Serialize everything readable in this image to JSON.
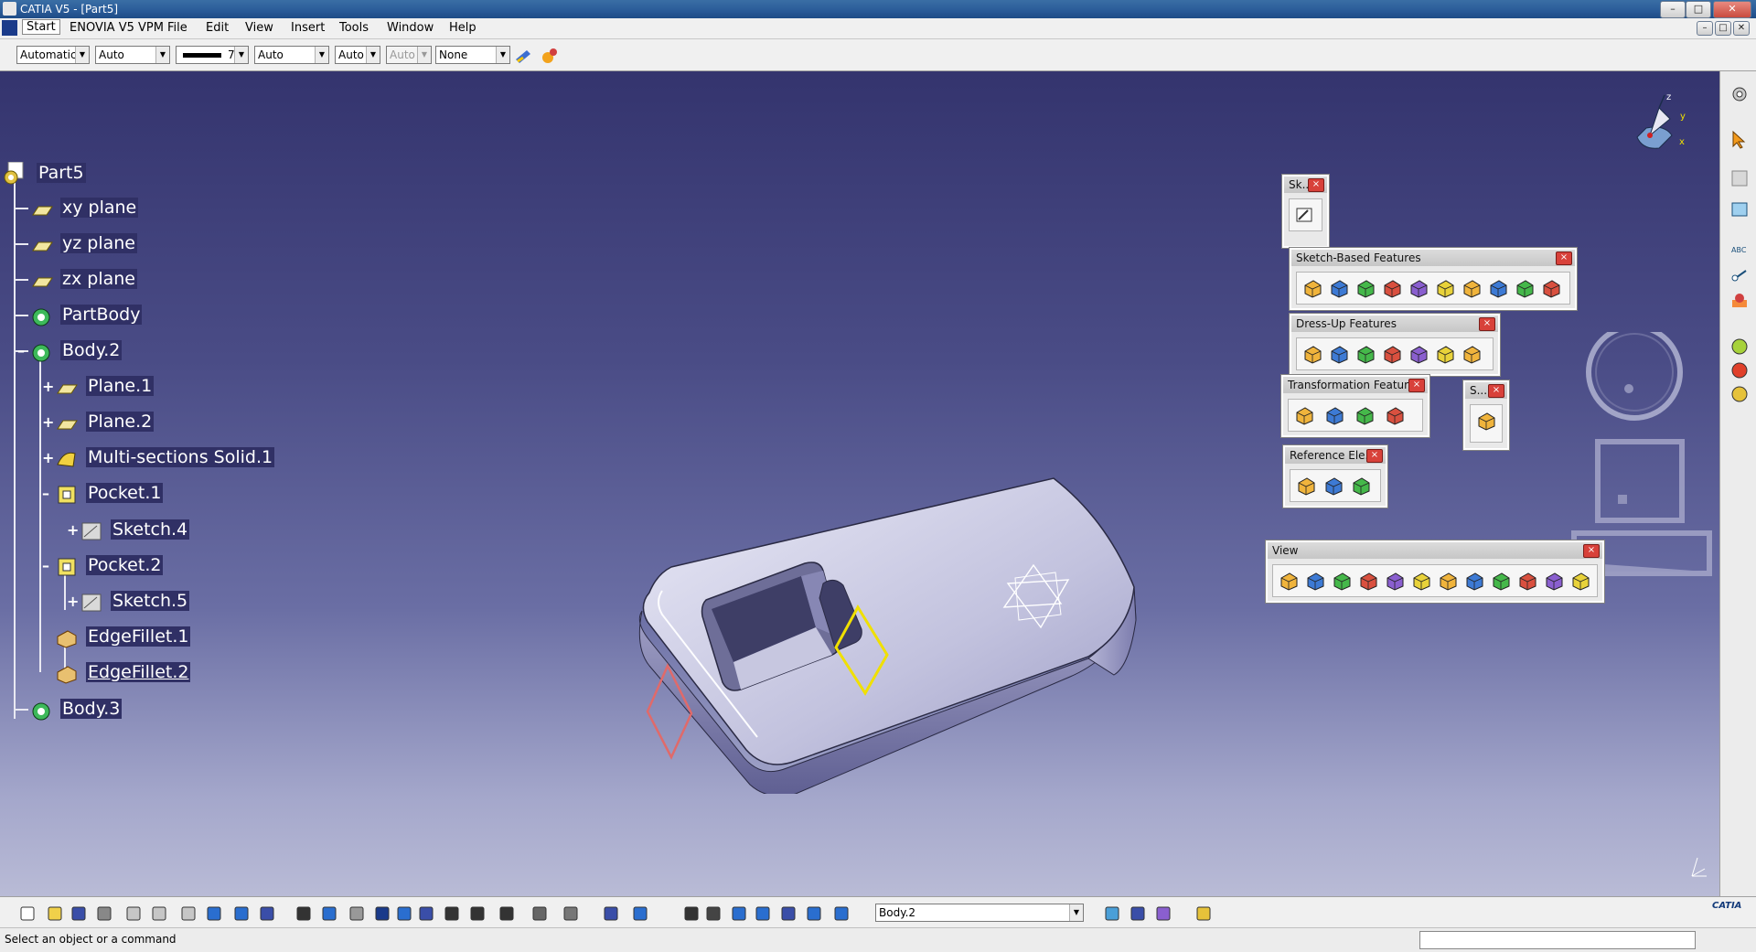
{
  "window": {
    "title": "CATIA V5 - [Part5]",
    "min": "–",
    "max": "□",
    "close": "✕",
    "child_min": "–",
    "child_max": "□",
    "child_close": "✕"
  },
  "menu": {
    "items": [
      "Start",
      "ENOVIA V5 VPM",
      "File",
      "Edit",
      "View",
      "Insert",
      "Tools",
      "Window",
      "Help"
    ]
  },
  "props": {
    "color": "Automatic",
    "transparency": "Auto",
    "line_weight": "7",
    "line_type": "Auto",
    "point_symbol": "Auto",
    "render_style": "Auto",
    "layer": "None"
  },
  "tree": {
    "root": "Part5",
    "items": [
      {
        "label": "xy plane",
        "icon": "plane-icon"
      },
      {
        "label": "yz plane",
        "icon": "plane-icon"
      },
      {
        "label": "zx plane",
        "icon": "plane-icon"
      },
      {
        "label": "PartBody",
        "icon": "body-icon"
      },
      {
        "label": "Body.2",
        "icon": "body-icon"
      },
      {
        "label": "Plane.1",
        "icon": "plane-icon"
      },
      {
        "label": "Plane.2",
        "icon": "plane-icon"
      },
      {
        "label": "Multi-sections Solid.1",
        "icon": "multisection-icon"
      },
      {
        "label": "Pocket.1",
        "icon": "pocket-icon"
      },
      {
        "label": "Sketch.4",
        "icon": "sketch-icon"
      },
      {
        "label": "Pocket.2",
        "icon": "pocket-icon"
      },
      {
        "label": "Sketch.5",
        "icon": "sketch-icon"
      },
      {
        "label": "EdgeFillet.1",
        "icon": "fillet-icon"
      },
      {
        "label": "EdgeFillet.2",
        "icon": "fillet-icon"
      },
      {
        "label": "Body.3",
        "icon": "body-icon"
      }
    ]
  },
  "toolbars": {
    "sketcher": {
      "title": "Sk...",
      "buttons": [
        "sketch-icon"
      ]
    },
    "sketch_based": {
      "title": "Sketch-Based Features",
      "buttons": [
        "pad-icon",
        "pocket-icon",
        "shaft-icon",
        "groove-icon",
        "hole-icon",
        "rib-icon",
        "slot-icon",
        "stiffener-icon",
        "multisection-solid-icon",
        "removed-multisection-icon"
      ]
    },
    "dress_up": {
      "title": "Dress-Up Features",
      "buttons": [
        "edge-fillet-icon",
        "chamfer-icon",
        "draft-icon",
        "shell-icon",
        "thickness-icon",
        "thread-icon",
        "remove-face-icon"
      ]
    },
    "transformation": {
      "title": "Transformation Features",
      "buttons": [
        "translation-icon",
        "mirror-icon",
        "rectangular-pattern-icon",
        "scaling-icon"
      ]
    },
    "surface": {
      "title": "S...",
      "buttons": [
        "split-icon"
      ]
    },
    "reference": {
      "title": "Reference Ele...",
      "buttons": [
        "point-icon",
        "line-icon",
        "plane-icon"
      ]
    },
    "view": {
      "title": "View",
      "buttons": [
        "fly-mode-icon",
        "fit-all-icon",
        "pan-icon",
        "rotate-icon",
        "zoom-in-icon",
        "zoom-out-icon",
        "normal-view-icon",
        "multi-view-icon",
        "iso-view-icon",
        "shading-icon",
        "hide-show-icon",
        "swap-space-icon"
      ]
    }
  },
  "compass": {
    "x": "x",
    "y": "y",
    "z": "z"
  },
  "current_body": "Body.2",
  "status": {
    "message": "Select an object or a command"
  },
  "brand": "CATIA"
}
